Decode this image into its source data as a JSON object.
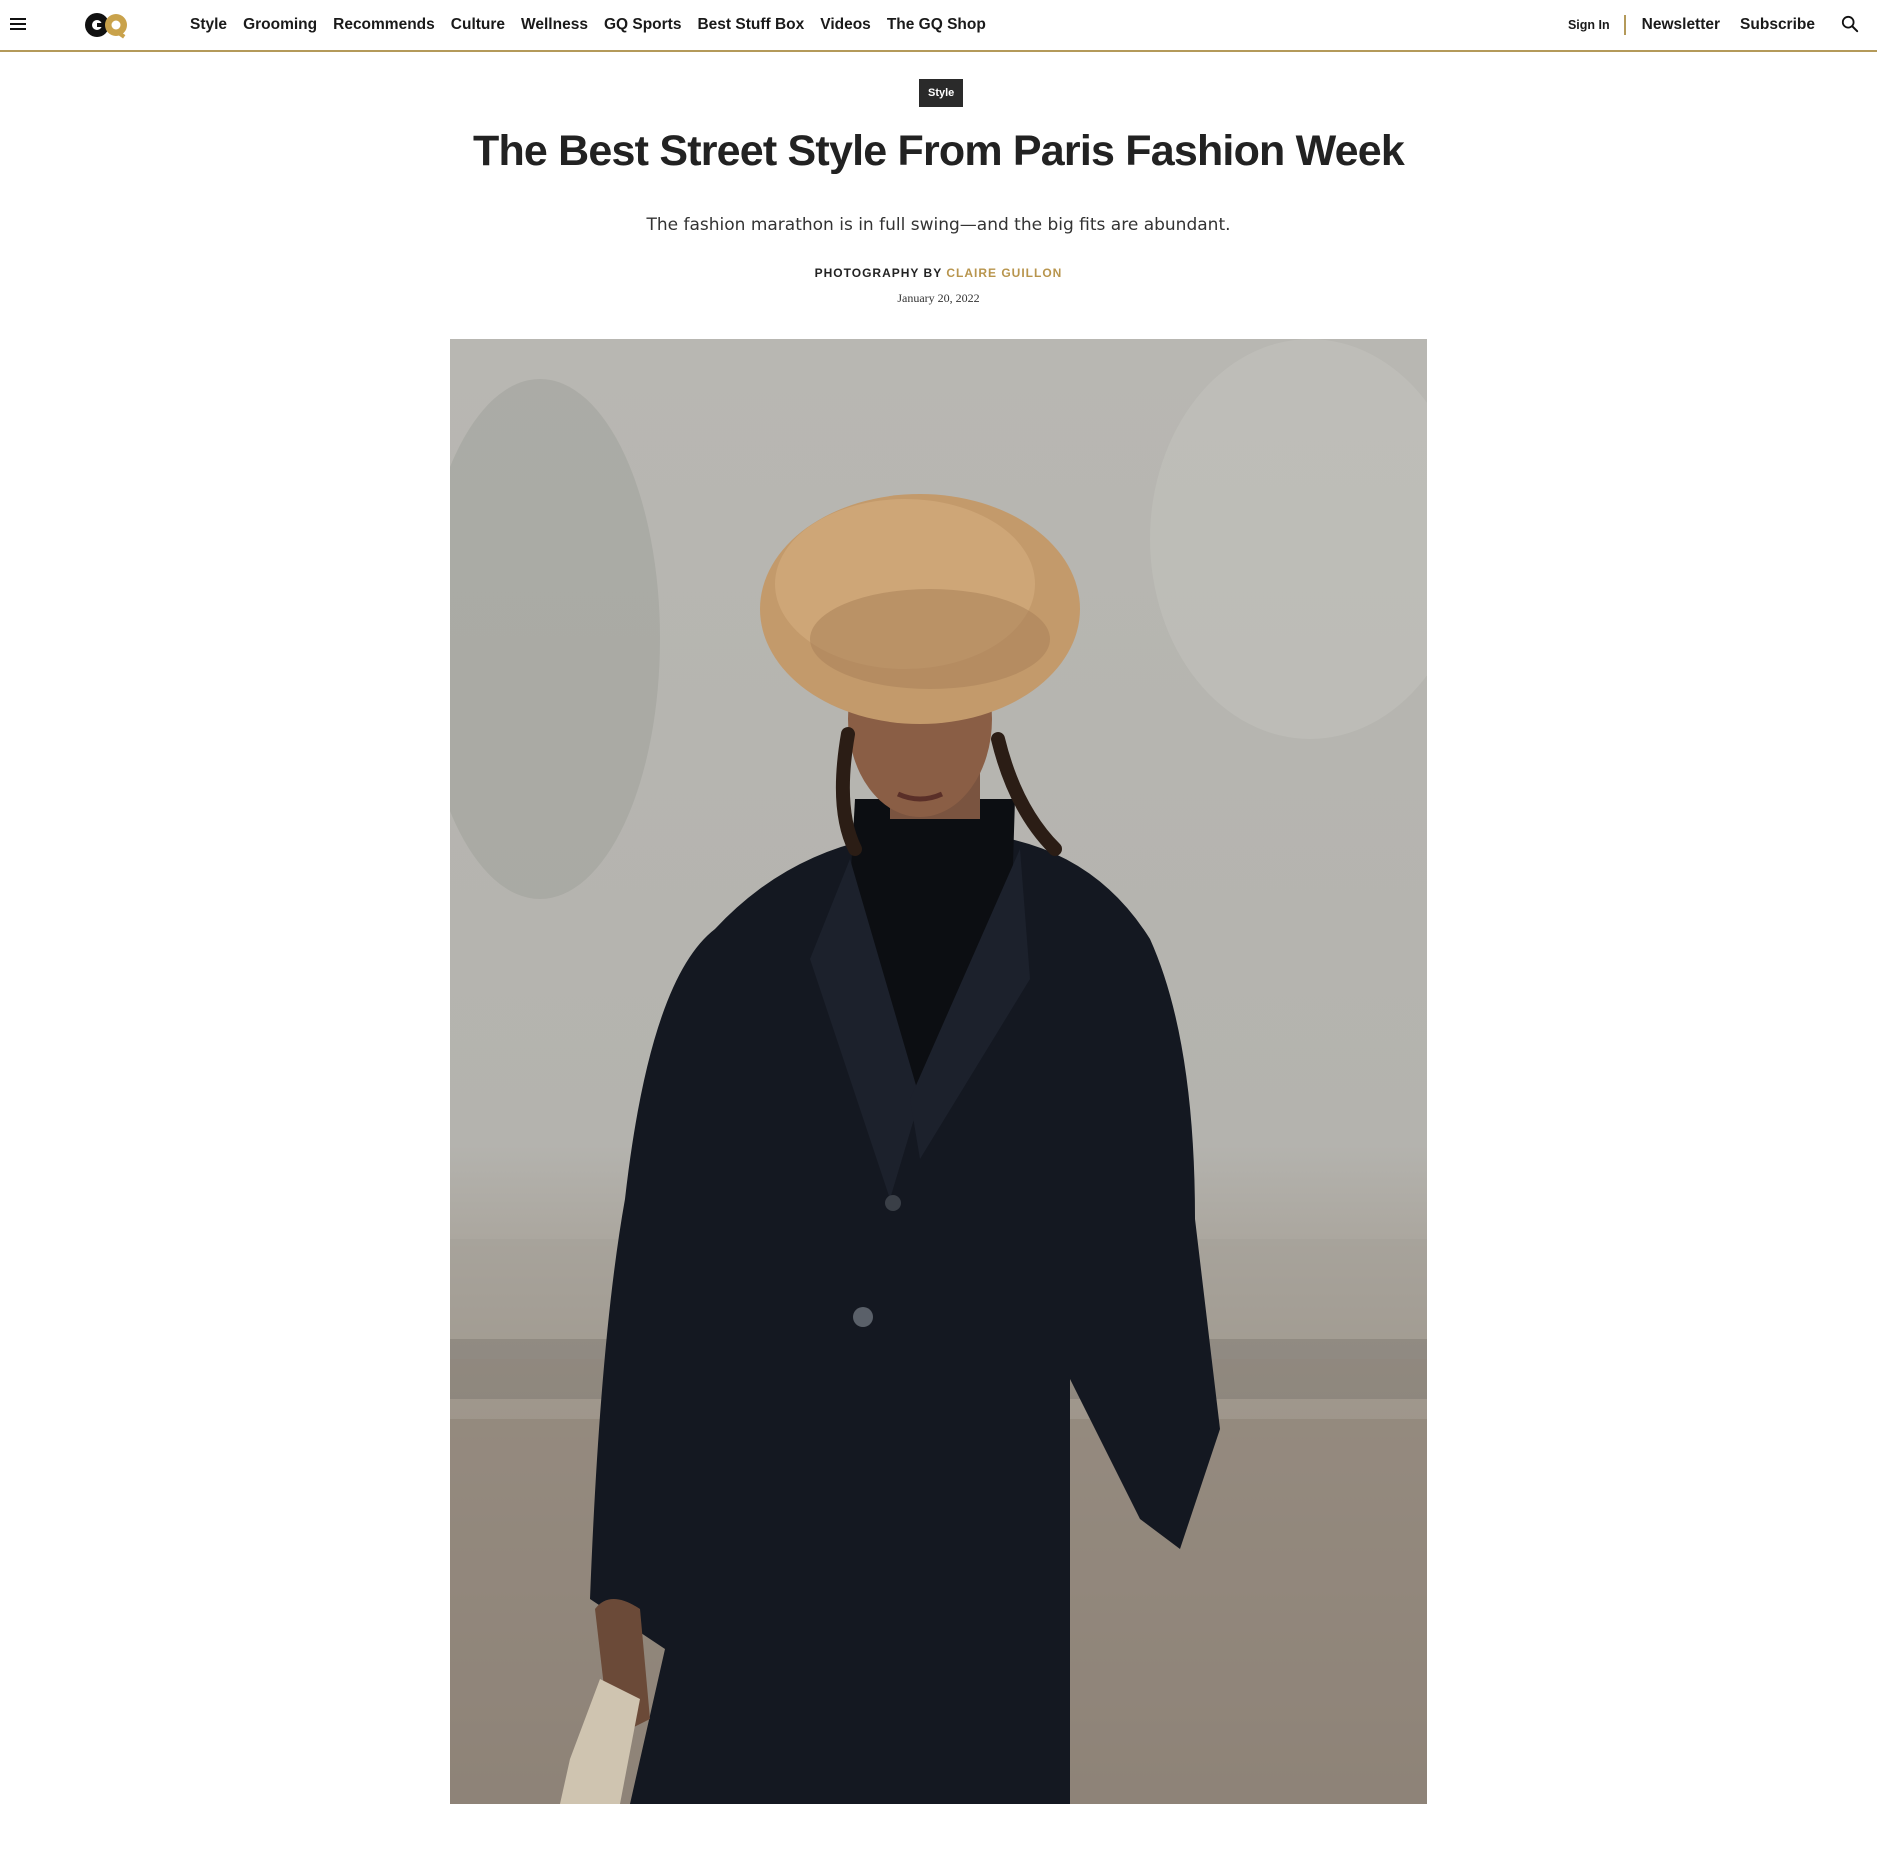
{
  "nav": {
    "links": [
      "Style",
      "Grooming",
      "Recommends",
      "Culture",
      "Wellness",
      "GQ Sports",
      "Best Stuff Box",
      "Videos",
      "The GQ Shop"
    ],
    "sign_in": "Sign In",
    "newsletter": "Newsletter",
    "subscribe": "Subscribe",
    "logo_text": "GQ"
  },
  "article": {
    "rubric": "Style",
    "headline": "The Best Street Style From Paris Fashion Week",
    "dek": "The fashion marathon is in full swing—and the big fits are abundant.",
    "byline_prefix": "PHOTOGRAPHY BY ",
    "byline_author": "CLAIRE GUILLON",
    "date": "January 20, 2022"
  },
  "colors": {
    "accent_gold": "#b49a5a",
    "author_gold": "#b8954d",
    "rubric_bg": "#2a2a2a"
  },
  "icons": {
    "menu": "hamburger-icon",
    "search": "magnifier-icon"
  }
}
